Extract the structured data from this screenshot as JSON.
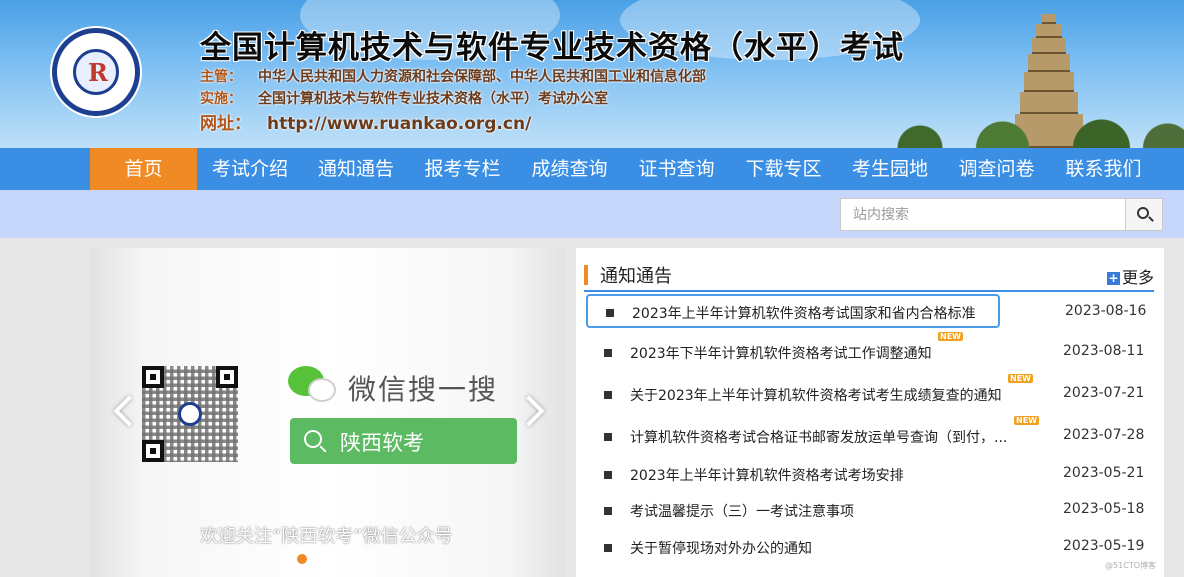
{
  "header": {
    "title": "全国计算机技术与软件专业技术资格（水平）考试",
    "sponsor_label": "主管：",
    "sponsor": "中华人民共和国人力资源和社会保障部、中华人民共和国工业和信息化部",
    "organizer_label": "实施：",
    "organizer": "全国计算机技术与软件专业技术资格（水平）考试办公室",
    "website_label": "网址：",
    "website": "http://www.ruankao.org.cn/",
    "logo_icon": "exam-seal-logo-icon"
  },
  "nav": {
    "items": [
      {
        "label": "首页",
        "active": true
      },
      {
        "label": "考试介绍"
      },
      {
        "label": "通知通告"
      },
      {
        "label": "报考专栏"
      },
      {
        "label": "成绩查询"
      },
      {
        "label": "证书查询"
      },
      {
        "label": "下载专区"
      },
      {
        "label": "考生园地"
      },
      {
        "label": "调查问卷"
      },
      {
        "label": "联系我们"
      }
    ]
  },
  "search": {
    "placeholder": "站内搜索",
    "button_icon": "search-icon"
  },
  "slider": {
    "wechat_text": "微信搜一搜",
    "wechat_search_label": "陕西软考",
    "caption": "欢迎关注“陕西软考”微信公众号",
    "active_slide": 1,
    "slide_count": 1
  },
  "notices": {
    "title": "通知通告",
    "more_label": "更多",
    "items": [
      {
        "text": "2023年上半年计算机软件资格考试国家和省内合格标准",
        "date": "2023-08-16",
        "is_new": false
      },
      {
        "text": "2023年下半年计算机软件资格考试工作调整通知",
        "date": "2023-08-11",
        "is_new": true
      },
      {
        "text": "关于2023年上半年计算机软件资格考试考生成绩复查的通知",
        "date": "2023-07-21",
        "is_new": true
      },
      {
        "text": "计算机软件资格考试合格证书邮寄发放运单号查询（到付，...",
        "date": "2023-07-28",
        "is_new": true
      },
      {
        "text": "2023年上半年计算机软件资格考试考场安排",
        "date": "2023-05-21",
        "is_new": false
      },
      {
        "text": "考试温馨提示（三）一考试注意事项",
        "date": "2023-05-18",
        "is_new": false
      },
      {
        "text": "关于暂停现场对外办公的通知",
        "date": "2023-05-19",
        "is_new": false
      }
    ],
    "new_badge": "NEW"
  },
  "watermark": "@51CTO博客",
  "colors": {
    "nav_bg": "#3a8ee4",
    "nav_active": "#f08a24",
    "search_bar_bg": "#c7d6fb",
    "wechat_green": "#5bba62",
    "notice_border": "#3a8ee4"
  }
}
